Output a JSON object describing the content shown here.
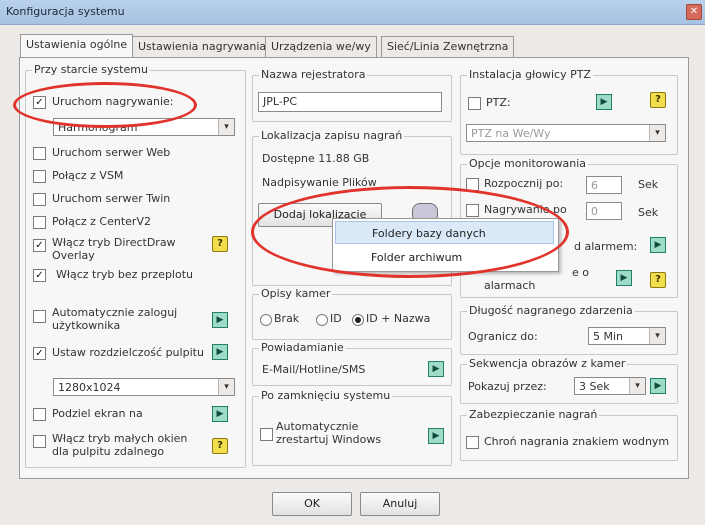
{
  "window": {
    "title": "Konfiguracja systemu",
    "close_label": "✕"
  },
  "tabs": [
    "Ustawienia ogólne",
    "Ustawienia nagrywania",
    "Urządzenia we/wy",
    "Sieć/Linia Zewnętrzna"
  ],
  "left": {
    "title": "Przy starcie systemu",
    "start_recording": "Uruchom nagrywanie:",
    "preset_value": "Harmonogram",
    "items": [
      "Uruchom serwer Web",
      "Połącz z VSM",
      "Uruchom serwer Twin",
      "Połącz z CenterV2"
    ],
    "directdraw": "Włącz tryb DirectDraw Overlay",
    "no_skip": "Włącz tryb bez przeplotu",
    "autologin": "Automatycznie zaloguj użytkownika",
    "set_resolution": "Ustaw rozdzielczość pulpitu",
    "resolution_value": "1280x1024",
    "split_screen": "Podziel ekran na",
    "small_windows": "Włącz tryb małych okien dla pulpitu zdalnego"
  },
  "recorder": {
    "title": "Nazwa rejestratora",
    "value": "JPL-PC"
  },
  "storage": {
    "title": "Lokalizacja zapisu nagrań",
    "available": "Dostępne 11.88 GB",
    "overwrite": "Nadpisywanie Plików",
    "add_button": "Dodaj lokalizacje"
  },
  "ptz": {
    "title": "Instalacja głowicy PTZ",
    "label": "PTZ:",
    "select_value": "PTZ na We/Wy"
  },
  "monitoring": {
    "title": "Opcje monitorowania",
    "start_after": "Rozpocznij po:",
    "record_after": "Nagrywanie po",
    "sek1": "Sek",
    "sek2": "Sek",
    "val1": "6",
    "val2": "0",
    "alarm": "d alarmem:",
    "alarms_info": "e o",
    "alarms": "alarmach"
  },
  "context_menu": {
    "items": [
      "Foldery bazy danych",
      "Folder archiwum"
    ]
  },
  "cameras": {
    "title": "Opisy kamer",
    "options": [
      "Brak",
      "ID",
      "ID + Nazwa"
    ]
  },
  "notify": {
    "title": "Powiadamianie",
    "value": "E-Mail/Hotline/SMS"
  },
  "shutdown": {
    "title": "Po zamknięciu systemu",
    "restart": "Automatycznie zrestartuj Windows"
  },
  "event": {
    "title": "Długość nagranego zdarzenia",
    "limit_label": "Ogranicz do:",
    "limit_value": "5 Min"
  },
  "sequence": {
    "title": "Sekwencja obrazów z kamer",
    "show_label": "Pokazuj przez:",
    "show_value": "3 Sek"
  },
  "security": {
    "title": "Zabezpieczanie nagrań",
    "watermark": "Chroń nagrania znakiem wodnym"
  },
  "footer": {
    "ok": "OK",
    "cancel": "Anuluj"
  },
  "icons": {
    "help": "?",
    "go": "▶",
    "dropdown": "▾",
    "check": "✓"
  }
}
